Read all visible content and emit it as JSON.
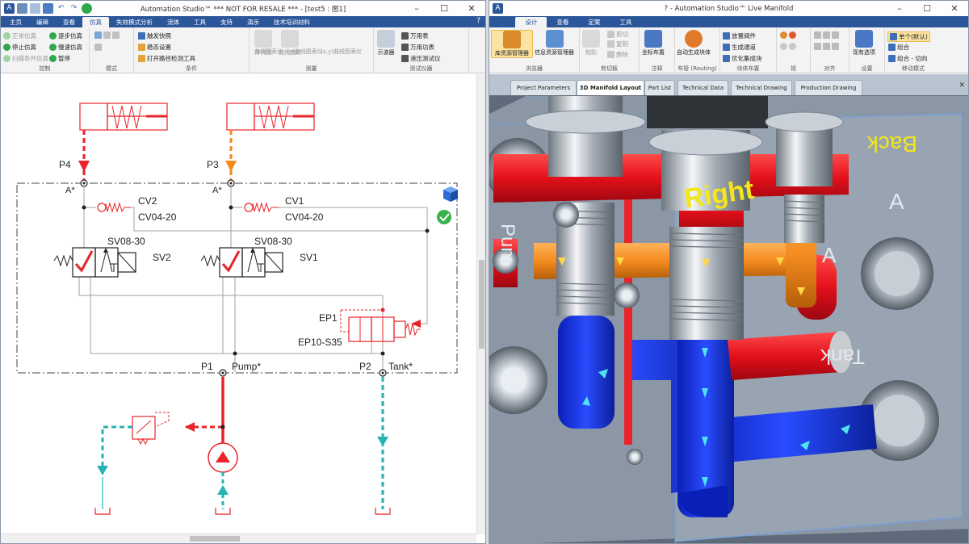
{
  "left_window": {
    "title": "Automation Studio™  *** NOT FOR RESALE ***  - [test5 : 图1]",
    "tabs": [
      "主页",
      "编辑",
      "查看",
      "仿真",
      "失效模式分析",
      "流体",
      "工具",
      "支持",
      "演示",
      "技术培训材料"
    ],
    "active_tab": "仿真",
    "ribbon": {
      "control": {
        "label": "控制",
        "items": [
          "正常仿真",
          "停止仿真",
          "扫描条件仿真",
          "逐步仿真",
          "慢速仿真",
          "暂停"
        ]
      },
      "mode": {
        "label": "模式"
      },
      "conditions": {
        "label": "条件",
        "items": [
          "触发快照",
          "稳态设置",
          "打开路径检测工具"
        ]
      },
      "measurement": {
        "label": "测量",
        "items": [
          "序列图",
          "曲线追踪",
          "曲线图表仪",
          "(x)曲线图表仪",
          "(x,y)曲线图表仪"
        ]
      },
      "test_instruments": {
        "label": "测试仪器",
        "items": [
          "示波器",
          "万用表",
          "万用功表",
          "液压测试仪"
        ]
      }
    },
    "schematic": {
      "ports": [
        {
          "name": "P4",
          "color": "#e8232a"
        },
        {
          "name": "P3",
          "color": "#f48b1f"
        },
        {
          "name": "P1",
          "color": "#e8232a"
        },
        {
          "name": "P2",
          "color": "#26b3b3"
        }
      ],
      "port_suffix_a": "A*",
      "pump_label": "Pump*",
      "tank_label": "Tank*",
      "cv2": {
        "name": "CV2",
        "model": "CV04-20"
      },
      "cv1": {
        "name": "CV1",
        "model": "CV04-20"
      },
      "sv2": {
        "model": "SV08-30",
        "name": "SV2"
      },
      "sv1": {
        "model": "SV08-30",
        "name": "SV1"
      },
      "ep1": {
        "name": "EP1",
        "model": "EP10-S35"
      }
    }
  },
  "right_window": {
    "title": "? - Automation Studio™ Live Manifold",
    "tabs": [
      "设计",
      "查看",
      "定案",
      "工具"
    ],
    "active_tab": "设计",
    "ribbon": {
      "browser": {
        "label": "浏览器",
        "items": [
          "库资源管理器",
          "信息资源管理器"
        ]
      },
      "clipboard": {
        "label": "剪切板",
        "items": [
          "粘贴",
          "剪切",
          "复制",
          "删除"
        ]
      },
      "annotation": {
        "label": "注释",
        "items": [
          "坐标布置"
        ]
      },
      "routing": {
        "label": "布管 (Routing)",
        "items": [
          "自动生成块体"
        ]
      },
      "block_placement": {
        "label": "块体布置",
        "items": [
          "放置阀件",
          "生成通道",
          "优化集成块"
        ]
      },
      "view": {
        "label": "视"
      },
      "align": {
        "label": "对齐"
      },
      "settings": {
        "label": "设置",
        "items": [
          "现有选项"
        ]
      },
      "move_mode": {
        "label": "移动模式",
        "items": [
          "单个(默认)",
          "组合",
          "组合 - 切向"
        ]
      }
    },
    "doc_tabs": [
      "Project Parameters",
      "3D Manifold Layout",
      "Part List",
      "Technical Data",
      "Technical Drawing",
      "Production Drawing"
    ],
    "active_doc_tab": "3D Manifold Layout",
    "face_labels": [
      "Back",
      "Right",
      "A",
      "A",
      "Tank",
      "Pum"
    ]
  },
  "colors": {
    "pressure_red": "#e8232a",
    "pilot_orange": "#f48b1f",
    "tank_cyan": "#26b3b3",
    "ribbon_blue": "#2b579a",
    "manifold_steel": "#8c97a6",
    "flow_blue": "#1030d8",
    "label_yellow": "#f3e61a"
  }
}
